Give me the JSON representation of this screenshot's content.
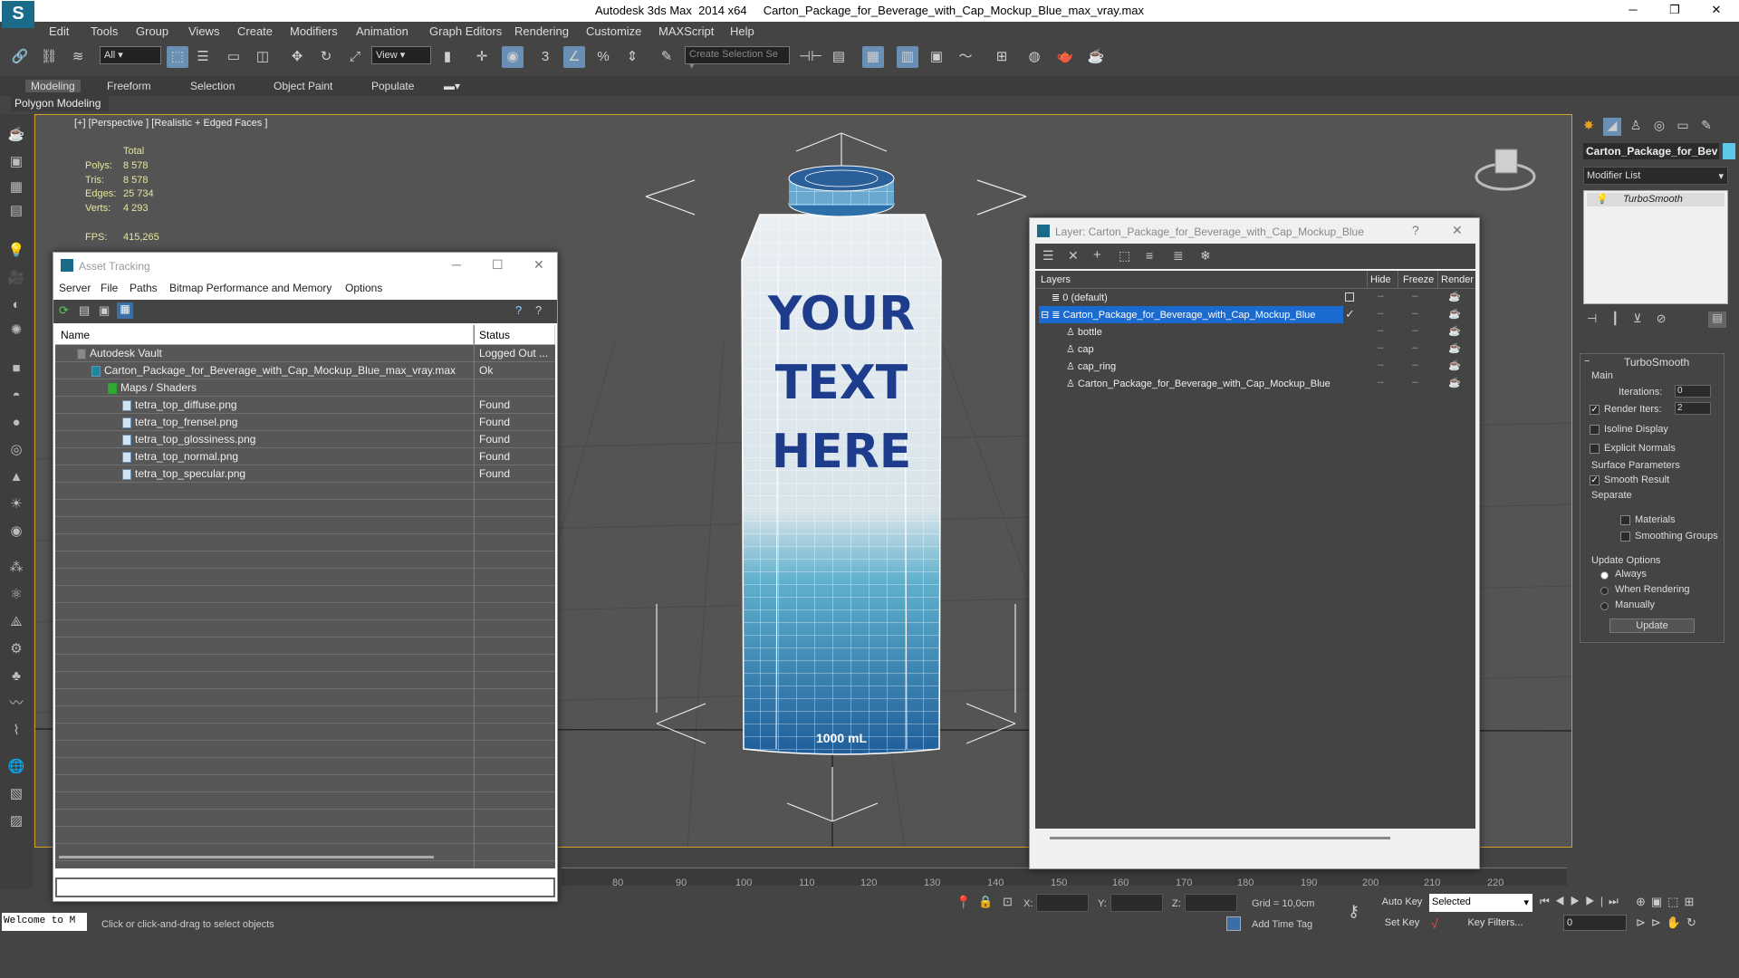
{
  "window": {
    "title_app": "Autodesk 3ds Max  2014 x64",
    "title_file": "Carton_Package_for_Beverage_with_Cap_Mockup_Blue_max_vray.max",
    "minimize": "─",
    "maximize": "❐",
    "close": "✕"
  },
  "menu": [
    "Edit",
    "Tools",
    "Group",
    "Views",
    "Create",
    "Modifiers",
    "Animation",
    "Graph Editors",
    "Rendering",
    "Customize",
    "MAXScript",
    "Help"
  ],
  "toolbar": {
    "filter_value": "All",
    "refcoord_value": "View",
    "selection_set_placeholder": "Create Selection Se"
  },
  "ribbon": {
    "tabs": [
      "Modeling",
      "Freeform",
      "Selection",
      "Object Paint",
      "Populate"
    ],
    "active_tab": "Modeling",
    "panel_label": "Polygon Modeling"
  },
  "viewport": {
    "label": "[+] [Perspective ] [Realistic + Edged Faces ]",
    "stats": {
      "header": "Total",
      "polys_label": "Polys:",
      "polys": "8 578",
      "tris_label": "Tris:",
      "tris": "8 578",
      "edges_label": "Edges:",
      "edges": "25 734",
      "verts_label": "Verts:",
      "verts": "4 293",
      "fps_label": "FPS:",
      "fps": "415,265"
    },
    "carton_text": [
      "YOUR",
      "TEXT",
      "HERE"
    ],
    "volume_text": "1000 mL",
    "timeline_ticks": [
      "80",
      "90",
      "100",
      "110",
      "120",
      "130",
      "140",
      "150",
      "160",
      "170",
      "180",
      "190",
      "200",
      "210",
      "220"
    ]
  },
  "asset_tracking": {
    "title": "Asset Tracking",
    "menu": [
      "Server",
      "File",
      "Paths",
      "Bitmap Performance and Memory",
      "Options"
    ],
    "col_name": "Name",
    "col_status": "Status",
    "rows": [
      {
        "name": "Autodesk Vault",
        "status": "Logged Out ..."
      },
      {
        "name": "Carton_Package_for_Beverage_with_Cap_Mockup_Blue_max_vray.max",
        "status": "Ok"
      },
      {
        "name": "Maps / Shaders",
        "status": ""
      },
      {
        "name": "tetra_top_diffuse.png",
        "status": "Found"
      },
      {
        "name": "tetra_top_frensel.png",
        "status": "Found"
      },
      {
        "name": "tetra_top_glossiness.png",
        "status": "Found"
      },
      {
        "name": "tetra_top_normal.png",
        "status": "Found"
      },
      {
        "name": "tetra_top_specular.png",
        "status": "Found"
      }
    ]
  },
  "layer_dialog": {
    "title": "Layer: Carton_Package_for_Beverage_with_Cap_Mockup_Blue",
    "help": "?",
    "close": "✕",
    "col_layers": "Layers",
    "col_hide": "Hide",
    "col_freeze": "Freeze",
    "col_render": "Render",
    "rows": [
      {
        "name": "0 (default)"
      },
      {
        "name": "Carton_Package_for_Beverage_with_Cap_Mockup_Blue"
      },
      {
        "name": "bottle"
      },
      {
        "name": "cap"
      },
      {
        "name": "cap_ring"
      },
      {
        "name": "Carton_Package_for_Beverage_with_Cap_Mockup_Blue"
      }
    ]
  },
  "command_panel": {
    "object_name": "Carton_Package_for_Bev",
    "modifier_list": "Modifier List",
    "stack_item": "TurboSmooth",
    "rollout_title": "TurboSmooth",
    "main_label": "Main",
    "iterations_label": "Iterations:",
    "iterations": "0",
    "render_iters_label": "Render Iters:",
    "render_iters": "2",
    "isoline": "Isoline Display",
    "explicit_normals": "Explicit Normals",
    "surface_params": "Surface Parameters",
    "smooth_result": "Smooth Result",
    "separate": "Separate",
    "materials": "Materials",
    "smoothing_groups": "Smoothing Groups",
    "update_options": "Update Options",
    "always": "Always",
    "when_rendering": "When Rendering",
    "manually": "Manually",
    "update_button": "Update"
  },
  "status": {
    "welcome": "Welcome to M",
    "message": "Click or click-and-drag to select objects",
    "x_label": "X:",
    "y_label": "Y:",
    "z_label": "Z:",
    "grid": "Grid = 10,0cm",
    "add_time_tag": "Add Time Tag",
    "auto_key": "Auto Key",
    "set_key": "Set Key",
    "selected": "Selected",
    "key_filters": "Key Filters...",
    "frame": "0"
  }
}
